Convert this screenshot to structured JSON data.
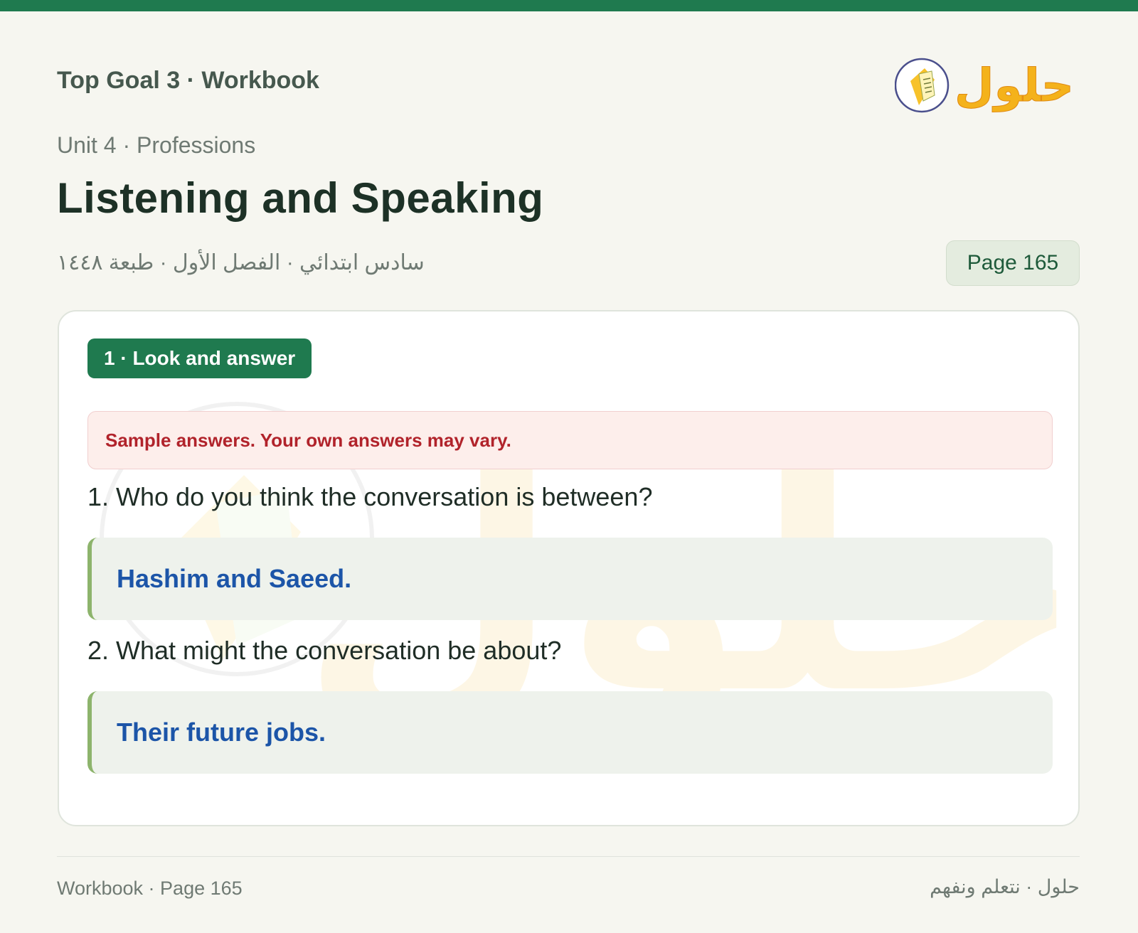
{
  "header": {
    "book_title": "Top Goal 3 · Workbook",
    "unit_line": "Unit 4 · Professions",
    "page_title": "Listening and Speaking",
    "arabic_meta": "سادس ابتدائي · الفصل الأول · طبعة ١٤٤٨",
    "page_badge": "Page 165",
    "logo_text": "حلول"
  },
  "section": {
    "label": "1 · Look and answer",
    "note": "Sample answers. Your own answers may vary.",
    "items": [
      {
        "question": "1. Who do you think the conversation is between?",
        "answer": "Hashim and Saeed."
      },
      {
        "question": "2. What might the conversation be about?",
        "answer": "Their future jobs."
      }
    ]
  },
  "footer": {
    "left": "Workbook · Page 165",
    "right": "حلول · نتعلم ونفهم"
  },
  "colors": {
    "accent": "#1f7a4f",
    "answer_text": "#1c55a8",
    "note_text": "#b1232b",
    "logo_gold": "#f4b21b"
  }
}
